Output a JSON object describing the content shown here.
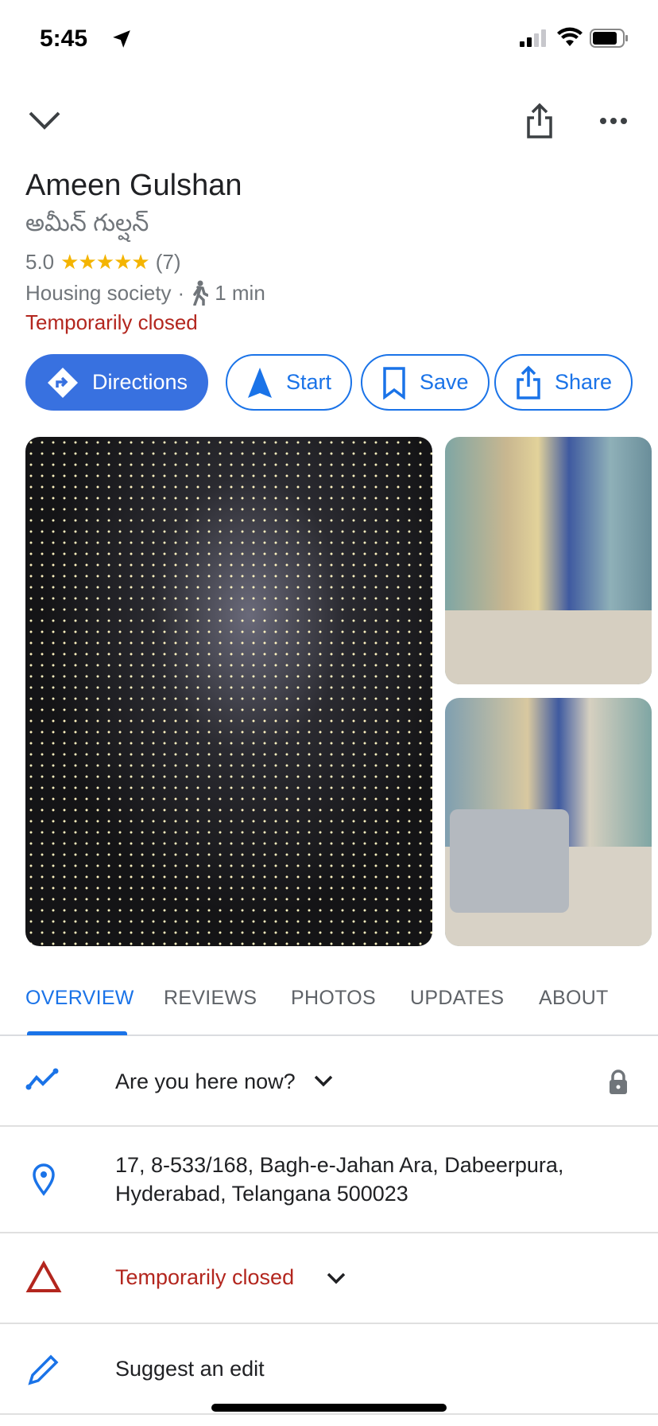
{
  "status_bar": {
    "time": "5:45"
  },
  "place": {
    "name": "Ameen Gulshan",
    "local_name": "అమీన్ గుల్షన్",
    "rating": "5.0",
    "stars": "★★★★★",
    "star_count": 5,
    "review_count": "(7)",
    "category": "Housing society",
    "separator": "·",
    "walk_time": "1 min",
    "status": "Temporarily closed"
  },
  "actions": [
    {
      "label": "Directions",
      "icon": "directions-icon"
    },
    {
      "label": "Start",
      "icon": "navigation-arrow-icon"
    },
    {
      "label": "Save",
      "icon": "bookmark-icon"
    },
    {
      "label": "Share",
      "icon": "share-icon"
    }
  ],
  "tabs": [
    {
      "label": "OVERVIEW",
      "active": true
    },
    {
      "label": "REVIEWS"
    },
    {
      "label": "PHOTOS"
    },
    {
      "label": "UPDATES"
    },
    {
      "label": "ABOUT"
    }
  ],
  "rows": {
    "here_now": "Are you here now?",
    "address_line1": "17, 8-533/168, Bagh-e-Jahan Ara, Dabeerpura,",
    "address_line2": "Hyderabad, Telangana 500023",
    "closed": "Temporarily closed",
    "suggest": "Suggest an edit"
  },
  "colors": {
    "accent": "#1a73e8",
    "closed": "#b3261e",
    "star": "#f4b400"
  }
}
